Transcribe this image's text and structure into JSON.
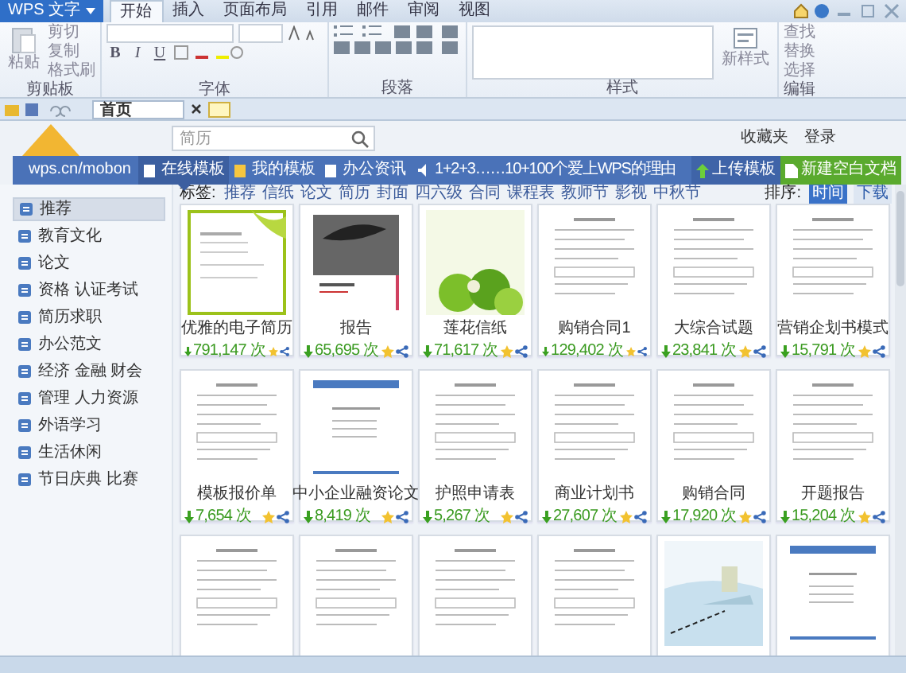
{
  "app_menu": {
    "label": "WPS 文字"
  },
  "ribbon_tabs": [
    {
      "label": "开始",
      "selected": true
    },
    {
      "label": "插入",
      "selected": false
    },
    {
      "label": "页面布局",
      "selected": false
    },
    {
      "label": "引用",
      "selected": false
    },
    {
      "label": "邮件",
      "selected": false
    },
    {
      "label": "审阅",
      "selected": false
    },
    {
      "label": "视图",
      "selected": false
    }
  ],
  "ribbon": {
    "clipboard": {
      "label": "剪贴板",
      "paste": "粘贴",
      "cut": "剪切",
      "copy": "复制",
      "format_painter": "格式刷"
    },
    "font": {
      "label": "字体",
      "styles": [
        "B",
        "I",
        "U"
      ]
    },
    "paragraph": {
      "label": "段落"
    },
    "styles": {
      "label": "样式",
      "new_style": "新样式"
    },
    "editing": {
      "label": "编辑",
      "find": "查找",
      "replace": "替换",
      "select": "选择"
    }
  },
  "document_tabs": [
    {
      "label": "首页",
      "selected": true
    }
  ],
  "header": {
    "search": {
      "placeholder": "简历"
    },
    "links": [
      "收藏夹",
      "登录"
    ]
  },
  "nav_bar": {
    "url": "wps.cn/mobon",
    "tabs": [
      {
        "label": "在线模板",
        "selected": true
      },
      {
        "label": "我的模板",
        "selected": false
      },
      {
        "label": "办公资讯",
        "selected": false
      }
    ],
    "slogan": "1+2+3……10+100个爱上WPS的理由",
    "buttons": [
      {
        "label": "上传模板",
        "kind": "upload"
      },
      {
        "label": "新建空白文档",
        "kind": "new"
      }
    ]
  },
  "sidebar": {
    "items": [
      {
        "label": "推荐",
        "selected": true
      },
      {
        "label": "教育文化",
        "selected": false
      },
      {
        "label": "论文",
        "selected": false
      },
      {
        "label": "资格 认证考试",
        "selected": false
      },
      {
        "label": "简历求职",
        "selected": false
      },
      {
        "label": "办公范文",
        "selected": false
      },
      {
        "label": "经济 金融 财会",
        "selected": false
      },
      {
        "label": "管理 人力资源",
        "selected": false
      },
      {
        "label": "外语学习",
        "selected": false
      },
      {
        "label": "生活休闲",
        "selected": false
      },
      {
        "label": "节日庆典 比赛",
        "selected": false
      }
    ]
  },
  "tags": {
    "label": "标签:",
    "items": [
      "推荐",
      "信纸",
      "论文",
      "简历",
      "封面",
      "四六级",
      "合同",
      "课程表",
      "教师节",
      "影视",
      "中秋节"
    ]
  },
  "sort": {
    "label": "排序:",
    "options": [
      {
        "label": "时间",
        "selected": true
      },
      {
        "label": "下载",
        "selected": false
      }
    ]
  },
  "templates": [
    [
      {
        "kind": "template",
        "title": "优雅的电子简历",
        "downloads": "791,147 次"
      },
      {
        "kind": "template",
        "title": "报告",
        "downloads": "65,695 次"
      },
      {
        "kind": "template",
        "title": "莲花信纸",
        "downloads": "71,617 次"
      },
      {
        "kind": "template",
        "title": "购销合同1",
        "downloads": "129,402 次"
      },
      {
        "kind": "template",
        "title": "大综合试题",
        "downloads": "23,841 次"
      },
      {
        "kind": "template",
        "title": "营销企划书模式",
        "downloads": "15,791 次"
      }
    ],
    [
      {
        "kind": "template",
        "title": "模板报价单",
        "downloads": "7,654 次"
      },
      {
        "kind": "template",
        "title": "中小企业融资论文",
        "downloads": "8,419 次"
      },
      {
        "kind": "template",
        "title": "护照申请表",
        "downloads": "5,267 次"
      },
      {
        "kind": "template",
        "title": "商业计划书",
        "downloads": "27,607 次"
      },
      {
        "kind": "template",
        "title": "购销合同",
        "downloads": "17,920 次"
      },
      {
        "kind": "template",
        "title": "开题报告",
        "downloads": "15,204 次"
      }
    ],
    [
      {
        "kind": "picture"
      },
      {
        "kind": "picture"
      },
      {
        "kind": "picture"
      },
      {
        "kind": "picture"
      },
      {
        "kind": "picture"
      },
      {
        "kind": "picture"
      }
    ]
  ]
}
